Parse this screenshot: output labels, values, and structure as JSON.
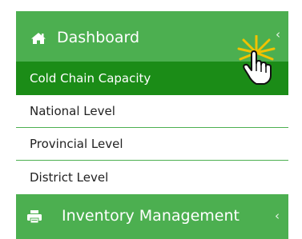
{
  "nav": {
    "dashboard": {
      "label": "Dashboard",
      "icon": "home-icon",
      "chevron": "‹"
    },
    "submenu": [
      {
        "label": "Cold Chain Capacity",
        "active": true
      },
      {
        "label": "National Level"
      },
      {
        "label": "Provincial Level"
      },
      {
        "label": "District Level"
      }
    ],
    "inventory": {
      "label": "Inventory Management",
      "icon": "printer-icon",
      "chevron": "‹"
    }
  },
  "colors": {
    "menu_green": "#4caf50",
    "active_green": "#1b8c17",
    "click_burst": "#f2c200"
  },
  "cursor": {
    "icon": "hand-pointer-icon",
    "effect": "click-burst"
  }
}
